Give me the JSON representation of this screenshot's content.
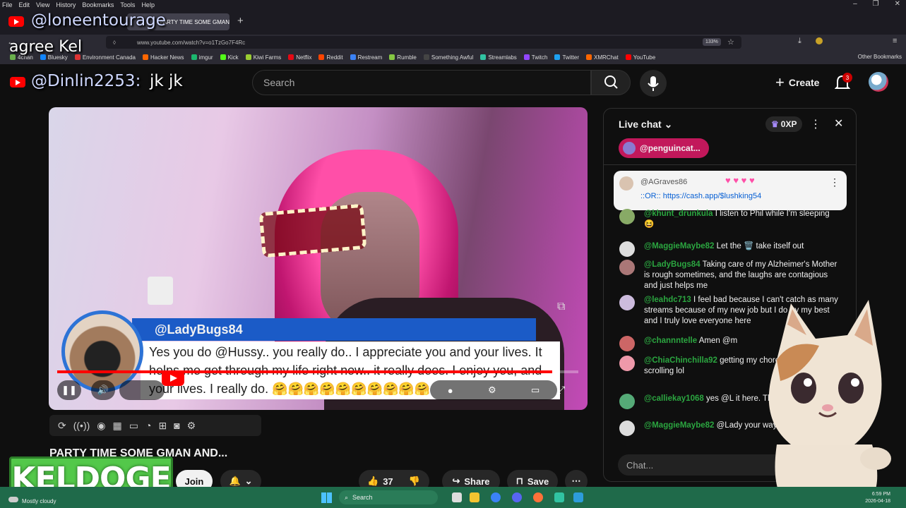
{
  "browser": {
    "menu": [
      "File",
      "Edit",
      "View",
      "History",
      "Bookmarks",
      "Tools",
      "Help"
    ],
    "tab_active_label": "PARTY TIME SOME GMAN...",
    "url": "www.youtube.com/watch?v=o1TzGo7F4Rc",
    "zoom": "133%",
    "bookmarks": [
      {
        "label": "4chan",
        "color": "#6ab04c"
      },
      {
        "label": "Bluesky",
        "color": "#1185fe"
      },
      {
        "label": "Environment Canada",
        "color": "#d33"
      },
      {
        "label": "Hacker News",
        "color": "#ff6600"
      },
      {
        "label": "imgur",
        "color": "#1bb76e"
      },
      {
        "label": "Kick",
        "color": "#53fc18"
      },
      {
        "label": "Kiwi Farms",
        "color": "#9acd32"
      },
      {
        "label": "Netflix",
        "color": "#e50914"
      },
      {
        "label": "Reddit",
        "color": "#ff4500"
      },
      {
        "label": "Restream",
        "color": "#3b82f6"
      },
      {
        "label": "Rumble",
        "color": "#85c742"
      },
      {
        "label": "Something Awful",
        "color": "#444"
      },
      {
        "label": "Streamlabs",
        "color": "#31c3a2"
      },
      {
        "label": "Twitch",
        "color": "#9146ff"
      },
      {
        "label": "Twitter",
        "color": "#1da1f2"
      },
      {
        "label": "XMRChat",
        "color": "#f60"
      },
      {
        "label": "YouTube",
        "color": "#f00"
      }
    ],
    "other_bookmarks": "Other Bookmarks"
  },
  "overlay": {
    "handle_1": "@loneentourage",
    "text_1": "agree Kel",
    "handle_2": "@Dinlin2253:",
    "text_2": "jk jk",
    "keldoge": "KELDOGE"
  },
  "youtube": {
    "search_placeholder": "Search",
    "create_label": "Create",
    "notif_count": "3",
    "video_title": "PARTY TIME SOME GMAN AND...",
    "join_label": "Join",
    "like_count": "37",
    "share_label": "Share",
    "save_label": "Save",
    "playback_progress": 0.95
  },
  "lower_third": {
    "name": "@LadyBugs84",
    "message": "Yes you do @Hussy.. you really do.. I appreciate you and your lives. It helps me get through my life right now.. it really does. I enjoy you, and your lives. I really do. 🤗🤗🤗🤗🤗🤗🤗🤗🤗🤗"
  },
  "chat": {
    "title": "Live chat",
    "xp": "0XP",
    "pinned_pill": "@penguincat...",
    "pinned_user": "@AGraves86",
    "pinned_text": "::OR:: https://cash.app/$lushking54",
    "input_placeholder": "Chat...",
    "messages": [
      {
        "user": "@khunt_drunkula",
        "text": "I listen to Phil while I'm sleeping 😆",
        "color": "#8a6"
      },
      {
        "user": "@MaggieMaybe82",
        "text": "Let the 🗑️ take itself out",
        "color": "#ddd"
      },
      {
        "user": "@LadyBugs84",
        "text": "Taking care of my Alzheimer's Mother is rough sometimes, and the laughs are contagious and just helps me",
        "color": "#a77"
      },
      {
        "user": "@leahdc713",
        "text": "I feel bad because I can't catch as many streams because of my new job but I do try my best and I truly love everyone here",
        "color": "#cbd"
      },
      {
        "user": "@channntelle",
        "text": "Amen @m",
        "color": "#c66"
      },
      {
        "user": "@ChiaChinchilla92",
        "text": "getting my chores done while scrolling lol",
        "color": "#e9a"
      },
      {
        "user": "@calliekay1068",
        "text": "yes @L it here. The other member a",
        "color": "#5a7"
      },
      {
        "user": "@MaggieMaybe82",
        "text": "@Lady your way,sweetie",
        "color": "#ddd"
      }
    ]
  },
  "taskbar": {
    "weather": "Mostly cloudy",
    "search": "Search",
    "time": "6:59 PM",
    "date": "2026-04-18"
  }
}
